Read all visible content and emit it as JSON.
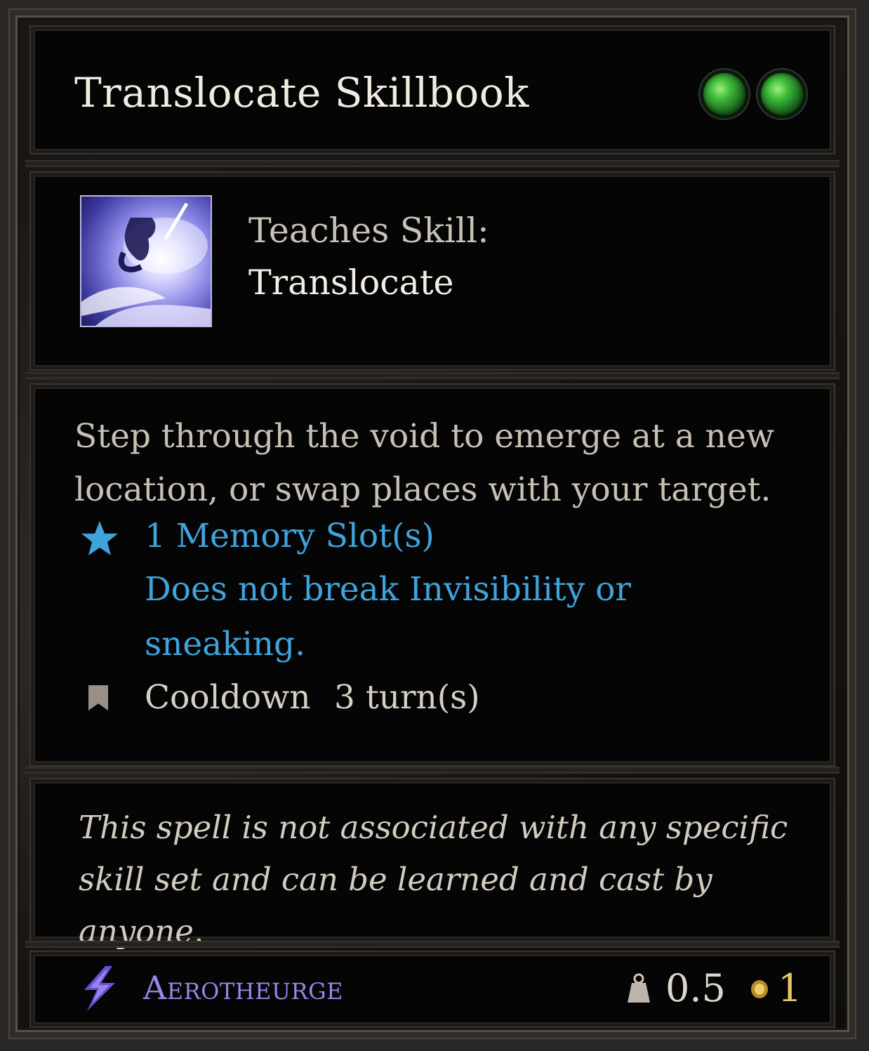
{
  "title": "Translocate Skillbook",
  "gems": [
    "green-gem",
    "green-gem"
  ],
  "teaches": {
    "label": "Teaches Skill:",
    "skill": "Translocate",
    "icon": "translocate-skill-icon"
  },
  "description": "Step through the void to emerge at a new location, or swap places with your target.",
  "properties": {
    "memory": "1 Memory Slot(s)",
    "invisibility_line1": "Does not break Invisibility or",
    "invisibility_line2": "sneaking.",
    "cooldown_label": "Cooldown",
    "cooldown_value": "3 turn(s)"
  },
  "note": "This spell  is not associated with any specific skill set and can be learned and cast by anyone.",
  "footer": {
    "school": "Aerotheurge",
    "weight": "0.5",
    "value": "1"
  },
  "colors": {
    "property_blue": "#3fa3dc",
    "school_purple": "#9b84e6",
    "gold": "#e8c46a",
    "gem_green": "#3fbb3a"
  }
}
